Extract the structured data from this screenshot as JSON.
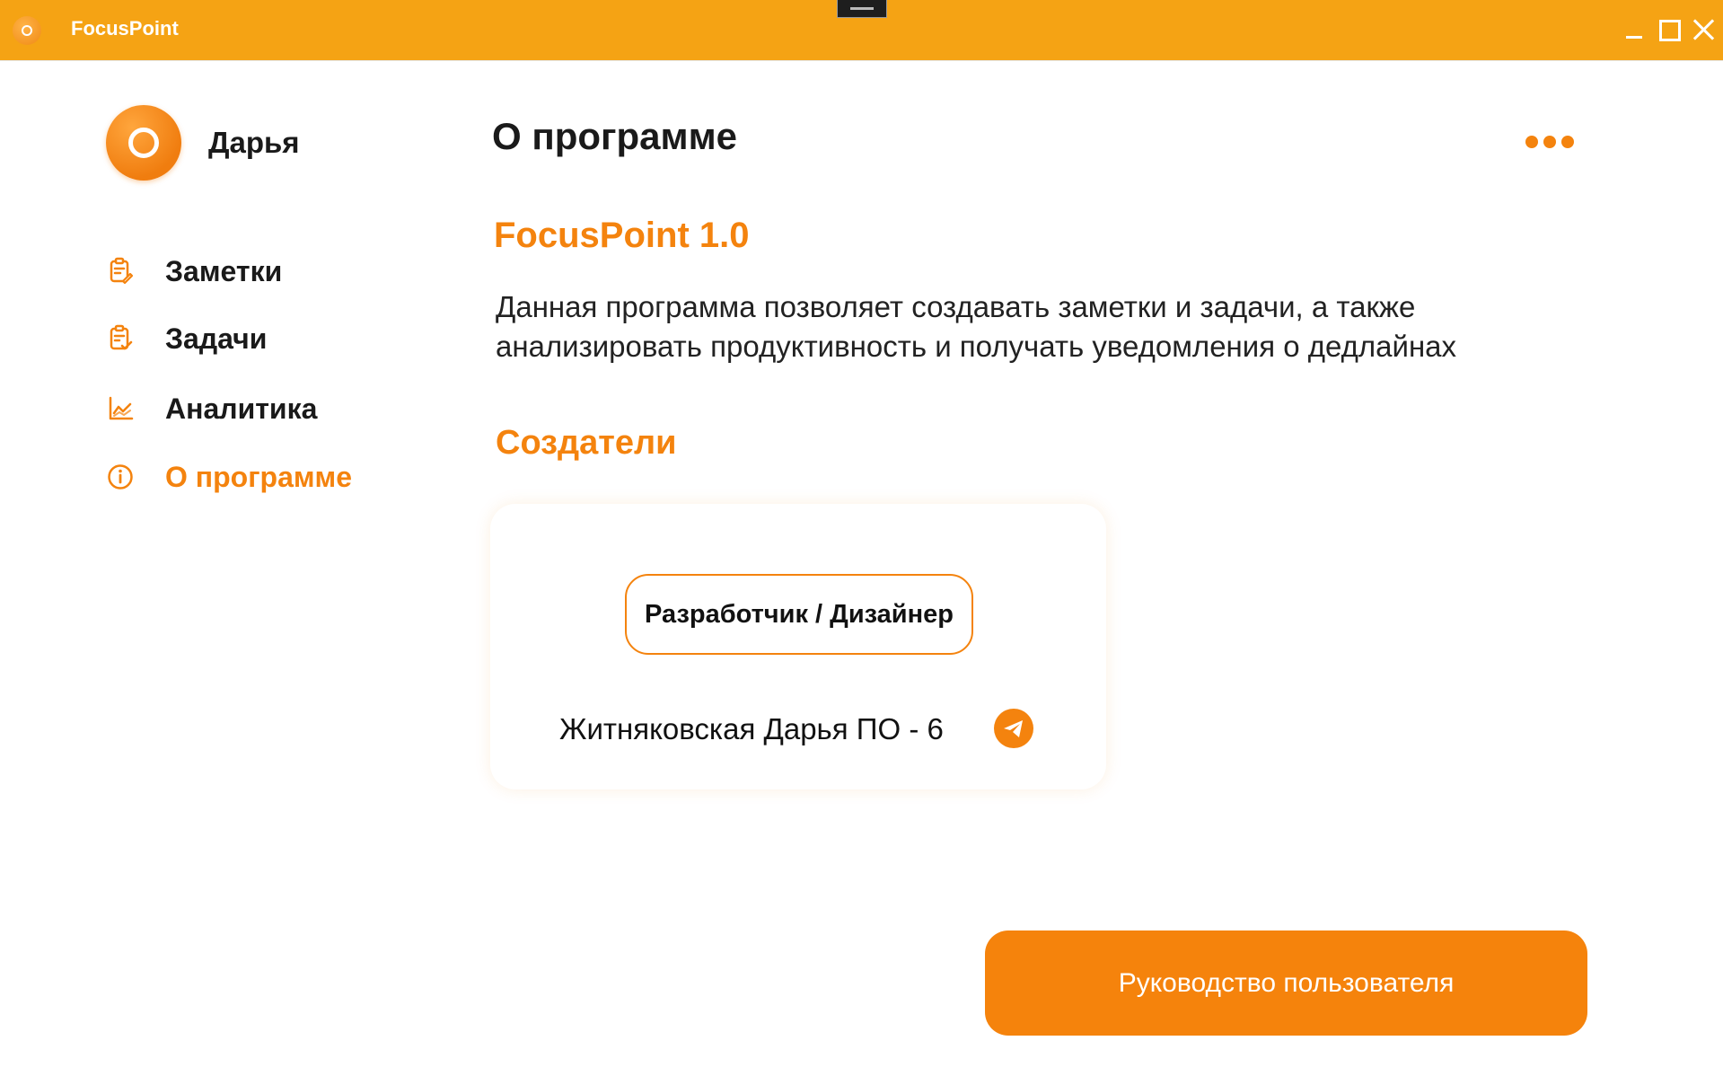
{
  "window": {
    "title": "FocusPoint",
    "icons": [
      "app-logo-icon",
      "minimize-icon",
      "maximize-icon",
      "close-icon"
    ]
  },
  "sidebar": {
    "user_name": "Дарья",
    "items": [
      {
        "label": "Заметки",
        "icon": "notes-icon",
        "active": false
      },
      {
        "label": "Задачи",
        "icon": "tasks-icon",
        "active": false
      },
      {
        "label": "Аналитика",
        "icon": "analytics-icon",
        "active": false
      },
      {
        "label": "О программе",
        "icon": "info-icon",
        "active": true
      }
    ]
  },
  "main": {
    "title": "О программе",
    "more_icon": "more-dots-icon",
    "version": "FocusPoint 1.0",
    "description": "Данная программа позволяет создавать заметки и задачи, а также анализировать продуктивность и получать уведомления о дедлайнах",
    "creators_heading": "Создатели",
    "creator_card": {
      "role": "Разработчик / Дизайнер",
      "name": "Житняковская Дарья ПО - 6",
      "contact_icon": "telegram-icon"
    },
    "guide_button": "Руководство пользователя"
  },
  "colors": {
    "titlebar": "#f5a314",
    "accent": "#f4830e",
    "text": "#1a1a1a",
    "background": "#ffffff"
  }
}
